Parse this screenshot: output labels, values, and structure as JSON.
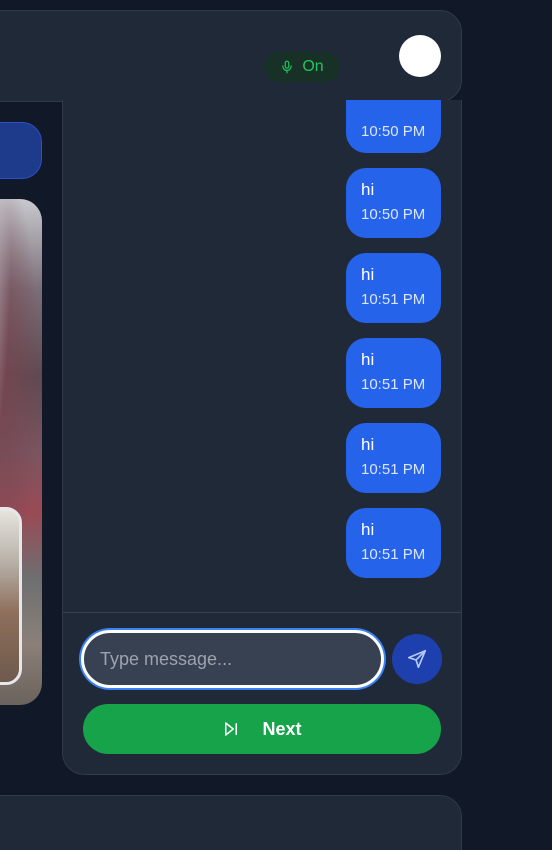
{
  "header": {
    "mic_status": "On",
    "mic_icon": "microphone-icon",
    "accent_green": "#22c55e"
  },
  "chat": {
    "messages": [
      {
        "text": "",
        "time": "10:50 PM"
      },
      {
        "text": "hi",
        "time": "10:50 PM"
      },
      {
        "text": "hi",
        "time": "10:51 PM"
      },
      {
        "text": "hi",
        "time": "10:51 PM"
      },
      {
        "text": "hi",
        "time": "10:51 PM"
      },
      {
        "text": "hi",
        "time": "10:51 PM"
      }
    ],
    "bubble_color": "#2563eb"
  },
  "composer": {
    "placeholder": "Type message...",
    "value": "",
    "send_icon": "send-icon"
  },
  "actions": {
    "next_label": "Next",
    "next_icon": "skip-forward-icon",
    "next_color": "#16a34a"
  }
}
